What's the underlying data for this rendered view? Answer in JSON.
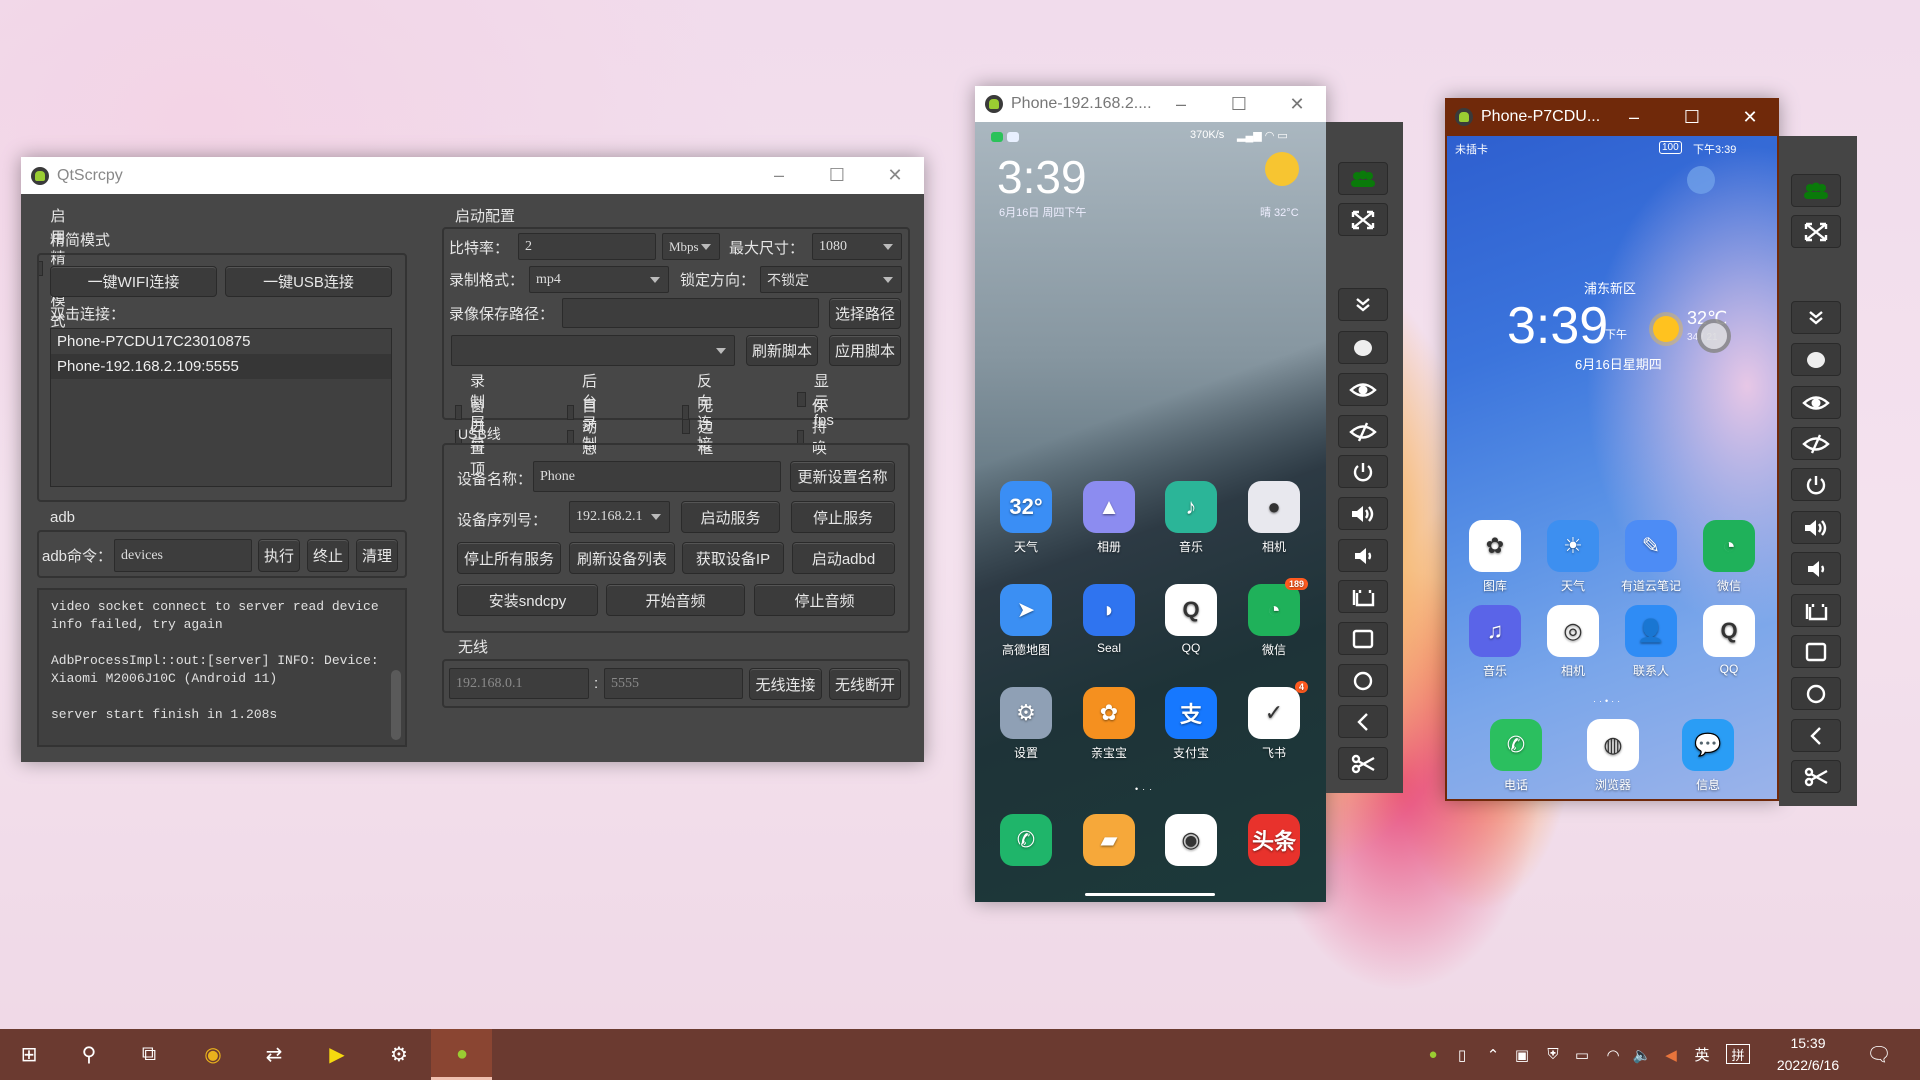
{
  "qtscrcpy": {
    "title": "QtScrcpy",
    "simple_mode_checkbox": "启用精简模式",
    "simple_mode_group": "精简模式",
    "wifi_connect": "一键WIFI连接",
    "usb_connect": "一键USB连接",
    "double_click_label": "双击连接：",
    "devices": [
      "Phone-P7CDU17C23010875",
      "Phone-192.168.2.109:5555"
    ],
    "adb_group": "adb",
    "adb_label": "adb命令：",
    "adb_value": "devices",
    "adb_exec": "执行",
    "adb_stop": "终止",
    "adb_clear": "清理",
    "log": "video socket connect to server read device info failed, try again\n\nAdbProcessImpl::out:[server] INFO: Device: Xiaomi M2006J10C (Android 11)\n\nserver start finish in 1.208s",
    "config": {
      "title": "启动配置",
      "bitrate_label": "比特率：",
      "bitrate_value": "2",
      "bitrate_unit": "Mbps",
      "max_size_label": "最大尺寸：",
      "max_size_value": "1080",
      "record_format_label": "录制格式：",
      "record_format_value": "mp4",
      "lock_orientation_label": "锁定方向：",
      "lock_orientation_value": "不锁定",
      "record_path_label": "录像保存路径：",
      "record_path_value": "",
      "select_path": "选择路径",
      "script_value": "",
      "refresh_script": "刷新脚本",
      "apply_script": "应用脚本",
      "checkboxes": [
        "录制屏幕",
        "后台录制",
        "反向连接",
        "显示fps",
        "窗口置顶",
        "自动息屏",
        "无边框",
        "保持唤醒"
      ]
    },
    "usb": {
      "title": "USB线",
      "device_name_label": "设备名称：",
      "device_name_value": "Phone",
      "update_name": "更新设置名称",
      "serial_label": "设备序列号：",
      "serial_value": "192.168.2.1",
      "start_server": "启动服务",
      "stop_server": "停止服务",
      "stop_all": "停止所有服务",
      "refresh_devices": "刷新设备列表",
      "get_ip": "获取设备IP",
      "start_adbd": "启动adbd",
      "install_sndcpy": "安装sndcpy",
      "start_audio": "开始音频",
      "stop_audio": "停止音频"
    },
    "wireless": {
      "title": "无线",
      "ip_placeholder": "192.168.0.1",
      "separator": ":",
      "port_placeholder": "5555",
      "connect": "无线连接",
      "disconnect": "无线断开"
    }
  },
  "phone1": {
    "title": "Phone-192.168.2....",
    "net_speed": "370K/s",
    "clock": "3:39",
    "date": "6月16日 周四下午",
    "weather": "晴  32°C",
    "apps": [
      {
        "label": "天气",
        "glyph": "32°",
        "color": "#3a8ef5"
      },
      {
        "label": "相册",
        "glyph": "▲",
        "color": "#8c8cf0"
      },
      {
        "label": "音乐",
        "glyph": "♪",
        "color": "#2bb598"
      },
      {
        "label": "相机",
        "glyph": "●",
        "color": "#e8e8ee"
      },
      {
        "label": "高德地图",
        "glyph": "➤",
        "color": "#3b8ff3"
      },
      {
        "label": "Seal",
        "glyph": "◗",
        "color": "#2f74f0"
      },
      {
        "label": "QQ",
        "glyph": "Q",
        "color": "#ffffff"
      },
      {
        "label": "微信",
        "glyph": "◔",
        "color": "#1fb15a",
        "badge": "189"
      },
      {
        "label": "设置",
        "glyph": "⚙",
        "color": "#8fa0b5"
      },
      {
        "label": "亲宝宝",
        "glyph": "✿",
        "color": "#f5901f"
      },
      {
        "label": "支付宝",
        "glyph": "支",
        "color": "#1678ff"
      },
      {
        "label": "飞书",
        "glyph": "✓",
        "color": "#ffffff",
        "badge": "4"
      }
    ],
    "dock": [
      {
        "glyph": "✆",
        "color": "#1fb56a"
      },
      {
        "glyph": "▰",
        "color": "#f6a83a"
      },
      {
        "glyph": "◉",
        "color": "#ffffff"
      },
      {
        "glyph": "头条",
        "color": "#e8322c"
      }
    ]
  },
  "phone2": {
    "title": "Phone-P7CDU...",
    "status_left": "未插卡",
    "battery": "100",
    "status_time": "下午3:39",
    "location": "浦东新区",
    "clock": "3:39",
    "ampm": "下午",
    "temp": "32℃",
    "temp_range": "34 / 21",
    "date": "6月16日星期四",
    "apps": [
      {
        "label": "图库",
        "glyph": "✿",
        "color": "#ffffff"
      },
      {
        "label": "天气",
        "glyph": "☀",
        "color": "#3d8ff0"
      },
      {
        "label": "有道云笔记",
        "glyph": "✎",
        "color": "#4d8cf5"
      },
      {
        "label": "微信",
        "glyph": "◔",
        "color": "#1fb15a"
      },
      {
        "label": "音乐",
        "glyph": "♫",
        "color": "#5a64e8"
      },
      {
        "label": "相机",
        "glyph": "◎",
        "color": "#ffffff"
      },
      {
        "label": "联系人",
        "glyph": "👤",
        "color": "#2f8cf5"
      },
      {
        "label": "QQ",
        "glyph": "Q",
        "color": "#ffffff"
      }
    ],
    "dock": [
      {
        "label": "电话",
        "glyph": "✆",
        "color": "#2bbf5f"
      },
      {
        "label": "浏览器",
        "glyph": "◍",
        "color": "#ffffff"
      },
      {
        "label": "信息",
        "glyph": "💬",
        "color": "#2a9df5"
      }
    ]
  },
  "toolbar_icons": [
    "users",
    "fullscreen",
    "expand-notifications",
    "touch",
    "eye",
    "eye-off",
    "power",
    "volume-up",
    "volume-down",
    "app-switch",
    "home-square",
    "home-circle",
    "back",
    "screenshot"
  ],
  "colors": {
    "toolbar_users": "#0a7a0a",
    "phone2_titlebar": "#70290a",
    "qt_body": "#474747"
  },
  "taskbar": {
    "apps": [
      "start",
      "search",
      "task-view",
      "chrome",
      "app-arrows",
      "potplayer",
      "settings",
      "qtscrcpy"
    ],
    "tray": [
      "android",
      "usb",
      "arrow",
      "security",
      "shield",
      "battery",
      "wifi",
      "volume",
      "mute"
    ],
    "ime": "英",
    "ime2": "拼",
    "time": "15:39",
    "date": "2022/6/16"
  }
}
